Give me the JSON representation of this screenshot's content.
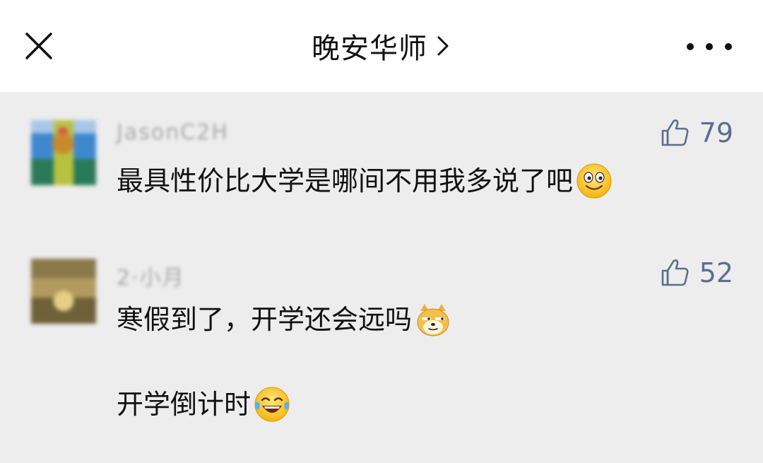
{
  "header": {
    "title": "晚安华师",
    "close_icon": "close-icon",
    "chevron_icon": "chevron-right-icon",
    "more_icon": "more-icon"
  },
  "comments": [
    {
      "username": "JasonC2H",
      "likes": "79",
      "text": "最具性价比大学是哪间不用我多说了吧",
      "emoji": "smile-emoji-icon"
    },
    {
      "username": "2·小月",
      "likes": "52",
      "text": "寒假到了，开学还会远吗",
      "emoji": "doge-emoji-icon",
      "text2": "开学倒计时",
      "emoji2": "laugh-cry-emoji-icon"
    }
  ],
  "colors": {
    "background": "#ededed",
    "header_bg": "#ffffff",
    "like_color": "#5c6d8f"
  }
}
